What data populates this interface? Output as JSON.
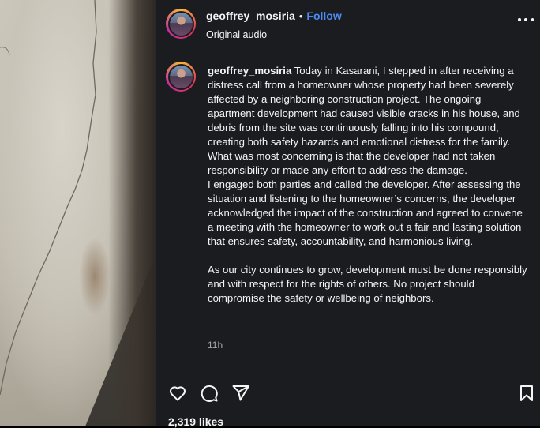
{
  "post": {
    "username": "geoffrey_mosiria",
    "dot": "•",
    "follow_label": "Follow",
    "audio_label": "Original audio"
  },
  "caption": {
    "username": "geoffrey_mosiria",
    "paragraph1": "Today in Kasarani, I stepped in after receiving a distress call from a homeowner whose property had been severely affected by a neighboring construction project. The ongoing apartment development had caused visible cracks in his house, and debris from the site was continuously falling into his compound, creating both safety hazards and emotional distress for the family. What was most concerning is that the developer had not taken responsibility or made any effort to address the damage.",
    "paragraph2": "I engaged both parties and called the developer. After assessing the situation and listening to the homeowner’s concerns, the developer acknowledged the impact of the construction and agreed to convene a meeting with the homeowner to work out a fair and lasting solution that ensures safety, accountability, and harmonious living.",
    "paragraph3": "As our city continues to grow, development must be done responsibly and with respect for the rights of others. No project should compromise the safety or wellbeing of neighbors.",
    "timestamp": "11h"
  },
  "actions": {
    "icons": [
      "heart-icon",
      "comment-icon",
      "share-icon",
      "bookmark-icon"
    ],
    "likes": "2,319 likes"
  },
  "colors": {
    "panel_bg": "#1b1c20",
    "follow": "#4c8bf5",
    "muted": "#a8a8a8"
  }
}
